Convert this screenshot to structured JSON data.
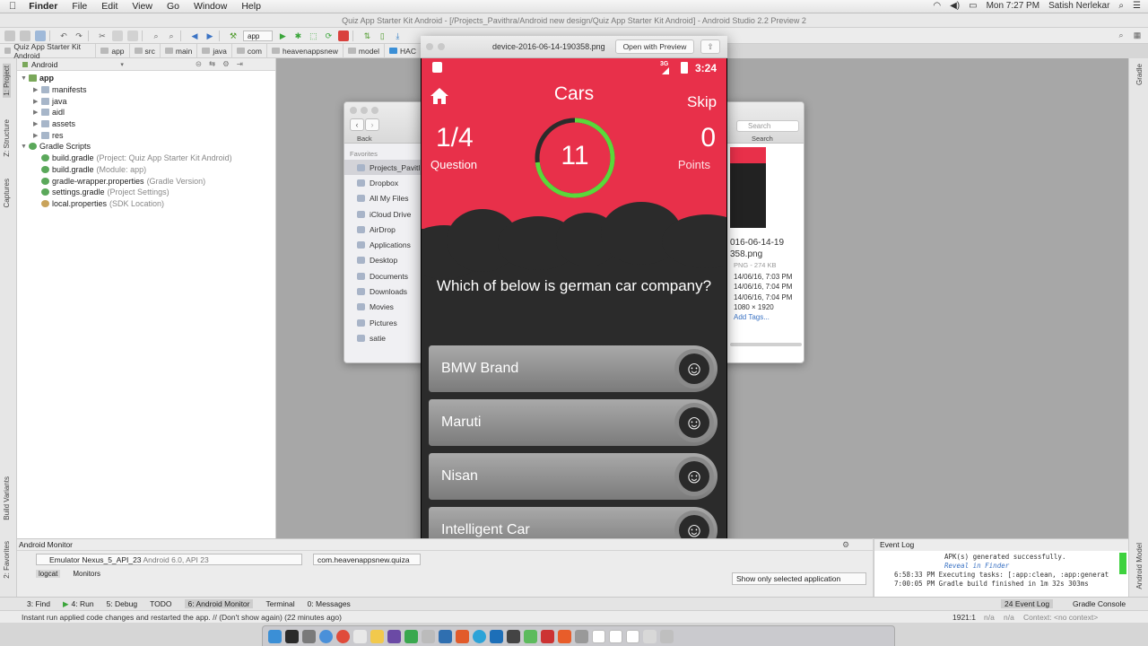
{
  "menubar": {
    "apple": "",
    "app": "Finder",
    "items": [
      "File",
      "Edit",
      "View",
      "Go",
      "Window",
      "Help"
    ],
    "clock": "Mon 7:27 PM",
    "user": "Satish Nerlekar"
  },
  "studio": {
    "title": "Quiz App Starter Kit Android - [/Projects_Pavithra/Android new design/Quiz App Starter Kit Android] - Android Studio 2.2 Preview 2",
    "run_config": "app",
    "breadcrumbs": [
      "Quiz App Starter Kit Android",
      "app",
      "src",
      "main",
      "java",
      "com",
      "heavenappsnew",
      "model",
      "HAC"
    ],
    "project_view": "Android",
    "left_tabs": {
      "project": "1: Project",
      "structure": "Z: Structure",
      "captures": "Captures",
      "build_variants": "Build Variants",
      "favorites": "2: Favorites"
    },
    "right_tabs": {
      "gradle": "Gradle",
      "android_model": "Android Model"
    },
    "tree": [
      {
        "label": "app",
        "sub": "",
        "level": 0,
        "type": "module"
      },
      {
        "label": "manifests",
        "sub": "",
        "level": 1,
        "type": "folder"
      },
      {
        "label": "java",
        "sub": "",
        "level": 1,
        "type": "folder"
      },
      {
        "label": "aidl",
        "sub": "",
        "level": 1,
        "type": "folder"
      },
      {
        "label": "assets",
        "sub": "",
        "level": 1,
        "type": "folder"
      },
      {
        "label": "res",
        "sub": "",
        "level": 1,
        "type": "folder"
      },
      {
        "label": "Gradle Scripts",
        "sub": "",
        "level": 0,
        "type": "gradle"
      },
      {
        "label": "build.gradle",
        "sub": "(Project: Quiz App Starter Kit Android)",
        "level": 1,
        "type": "gradle"
      },
      {
        "label": "build.gradle",
        "sub": "(Module: app)",
        "level": 1,
        "type": "gradle"
      },
      {
        "label": "gradle-wrapper.properties",
        "sub": "(Gradle Version)",
        "level": 1,
        "type": "gradle"
      },
      {
        "label": "settings.gradle",
        "sub": "(Project Settings)",
        "level": 1,
        "type": "gradle"
      },
      {
        "label": "local.properties",
        "sub": "(SDK Location)",
        "level": 1,
        "type": "props"
      }
    ],
    "monitor": {
      "title": "Android Monitor",
      "device": "Emulator Nexus_5_API_23",
      "device_sub": "Android 6.0, API 23",
      "package": "com.heavenappsnew.quiza",
      "tabs": [
        "logcat",
        "Monitors"
      ],
      "filter": "Show only selected application"
    },
    "event_log": {
      "title": "Event Log",
      "lines": [
        "APK(s) generated successfully.",
        "Reveal in Finder",
        "6:58:33 PM Executing tasks: [:app:clean, :app:generat",
        "7:00:05 PM Gradle build finished in 1m 32s 303ms"
      ]
    },
    "tool_windows": [
      "3: Find",
      "4: Run",
      "5: Debug",
      "TODO",
      "6: Android Monitor",
      "Terminal",
      "0: Messages"
    ],
    "tool_windows_right": [
      "24 Event Log",
      "Gradle Console"
    ],
    "status": "Instant run applied code changes and restarted the app. // (Don't show again) (22 minutes ago)",
    "cursor_pos": "1921:1",
    "na1": "n/a",
    "na2": "n/a",
    "context": "Context: <no context>"
  },
  "finder": {
    "back": "Back",
    "search_placeholder": "Search",
    "search_label": "Search",
    "favorites_label": "Favorites",
    "favorites": [
      "Projects_Pavitl",
      "Dropbox",
      "All My Files",
      "iCloud Drive",
      "AirDrop",
      "Applications",
      "Desktop",
      "Documents",
      "Downloads",
      "Movies",
      "Pictures",
      "satie"
    ],
    "file_name_1": "016-06-14-19",
    "file_name_2": "358.png",
    "file_kind": "PNG - 274 KB",
    "created": "14/06/16, 7:03 PM",
    "modified": "14/06/16, 7:04 PM",
    "opened": "14/06/16, 7:04 PM",
    "dimensions": "1080 × 1920",
    "add_tags": "Add Tags..."
  },
  "preview": {
    "filename": "device-2016-06-14-190358.png",
    "open_button": "Open with Preview"
  },
  "quiz": {
    "network": "3G",
    "time": "3:24",
    "category": "Cars",
    "skip": "Skip",
    "progress": "1/4",
    "progress_label": "Question",
    "timer": "11",
    "timer_fraction": 0.73,
    "points": "0",
    "points_label": "Points",
    "question": "Which of below is german car company?",
    "answers": [
      "BMW Brand",
      "Maruti",
      "Nisan",
      "Intelligent Car"
    ],
    "smiley": "☺",
    "colors": {
      "primary": "#e8304a",
      "dark": "#2b2b2b",
      "timer_ring": "#5bd83a"
    }
  }
}
